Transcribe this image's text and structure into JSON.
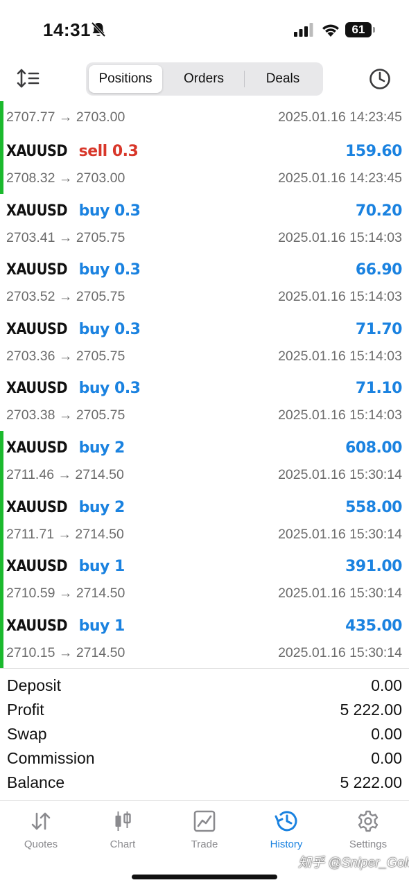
{
  "status_bar": {
    "time": "14:31",
    "battery": "61"
  },
  "header": {
    "tabs": [
      {
        "label": "Positions"
      },
      {
        "label": "Orders"
      },
      {
        "label": "Deals"
      }
    ],
    "active_tab": "Positions"
  },
  "deals": {
    "first_partial": {
      "prices": "2707.77 → 2703.00",
      "time": "2025.01.16 14:23:45"
    },
    "rows": [
      {
        "symbol": "XAUUSD",
        "type": "sell 0.3",
        "profit": "159.60",
        "prices": "2708.32 → 2703.00",
        "time": "2025.01.16 14:23:45"
      },
      {
        "symbol": "XAUUSD",
        "type": "buy 0.3",
        "profit": "70.20",
        "prices": "2703.41 → 2705.75",
        "time": "2025.01.16 15:14:03"
      },
      {
        "symbol": "XAUUSD",
        "type": "buy 0.3",
        "profit": "66.90",
        "prices": "2703.52 → 2705.75",
        "time": "2025.01.16 15:14:03"
      },
      {
        "symbol": "XAUUSD",
        "type": "buy 0.3",
        "profit": "71.70",
        "prices": "2703.36 → 2705.75",
        "time": "2025.01.16 15:14:03"
      },
      {
        "symbol": "XAUUSD",
        "type": "buy 0.3",
        "profit": "71.10",
        "prices": "2703.38 → 2705.75",
        "time": "2025.01.16 15:14:03"
      },
      {
        "symbol": "XAUUSD",
        "type": "buy 2",
        "profit": "608.00",
        "prices": "2711.46 → 2714.50",
        "time": "2025.01.16 15:30:14"
      },
      {
        "symbol": "XAUUSD",
        "type": "buy 2",
        "profit": "558.00",
        "prices": "2711.71 → 2714.50",
        "time": "2025.01.16 15:30:14"
      },
      {
        "symbol": "XAUUSD",
        "type": "buy 1",
        "profit": "391.00",
        "prices": "2710.59 → 2714.50",
        "time": "2025.01.16 15:30:14"
      },
      {
        "symbol": "XAUUSD",
        "type": "buy 1",
        "profit": "435.00",
        "prices": "2710.15 → 2714.50",
        "time": "2025.01.16 15:30:14"
      }
    ]
  },
  "summary": {
    "deposit_label": "Deposit",
    "deposit_value": "0.00",
    "profit_label": "Profit",
    "profit_value": "5 222.00",
    "swap_label": "Swap",
    "swap_value": "0.00",
    "commission_label": "Commission",
    "commission_value": "0.00",
    "balance_label": "Balance",
    "balance_value": "5 222.00"
  },
  "tabbar": {
    "items": [
      {
        "label": "Quotes",
        "icon": "quotes-arrows-icon"
      },
      {
        "label": "Chart",
        "icon": "candlestick-icon"
      },
      {
        "label": "Trade",
        "icon": "trade-chart-icon"
      },
      {
        "label": "History",
        "icon": "history-clock-icon"
      },
      {
        "label": "Settings",
        "icon": "gear-icon"
      }
    ],
    "active": "History"
  },
  "watermark": "知乎 @Sniper_Gold",
  "colors": {
    "accent_blue": "#1a82e0",
    "sell_red": "#d8372a",
    "group_green": "#1bb92d"
  }
}
